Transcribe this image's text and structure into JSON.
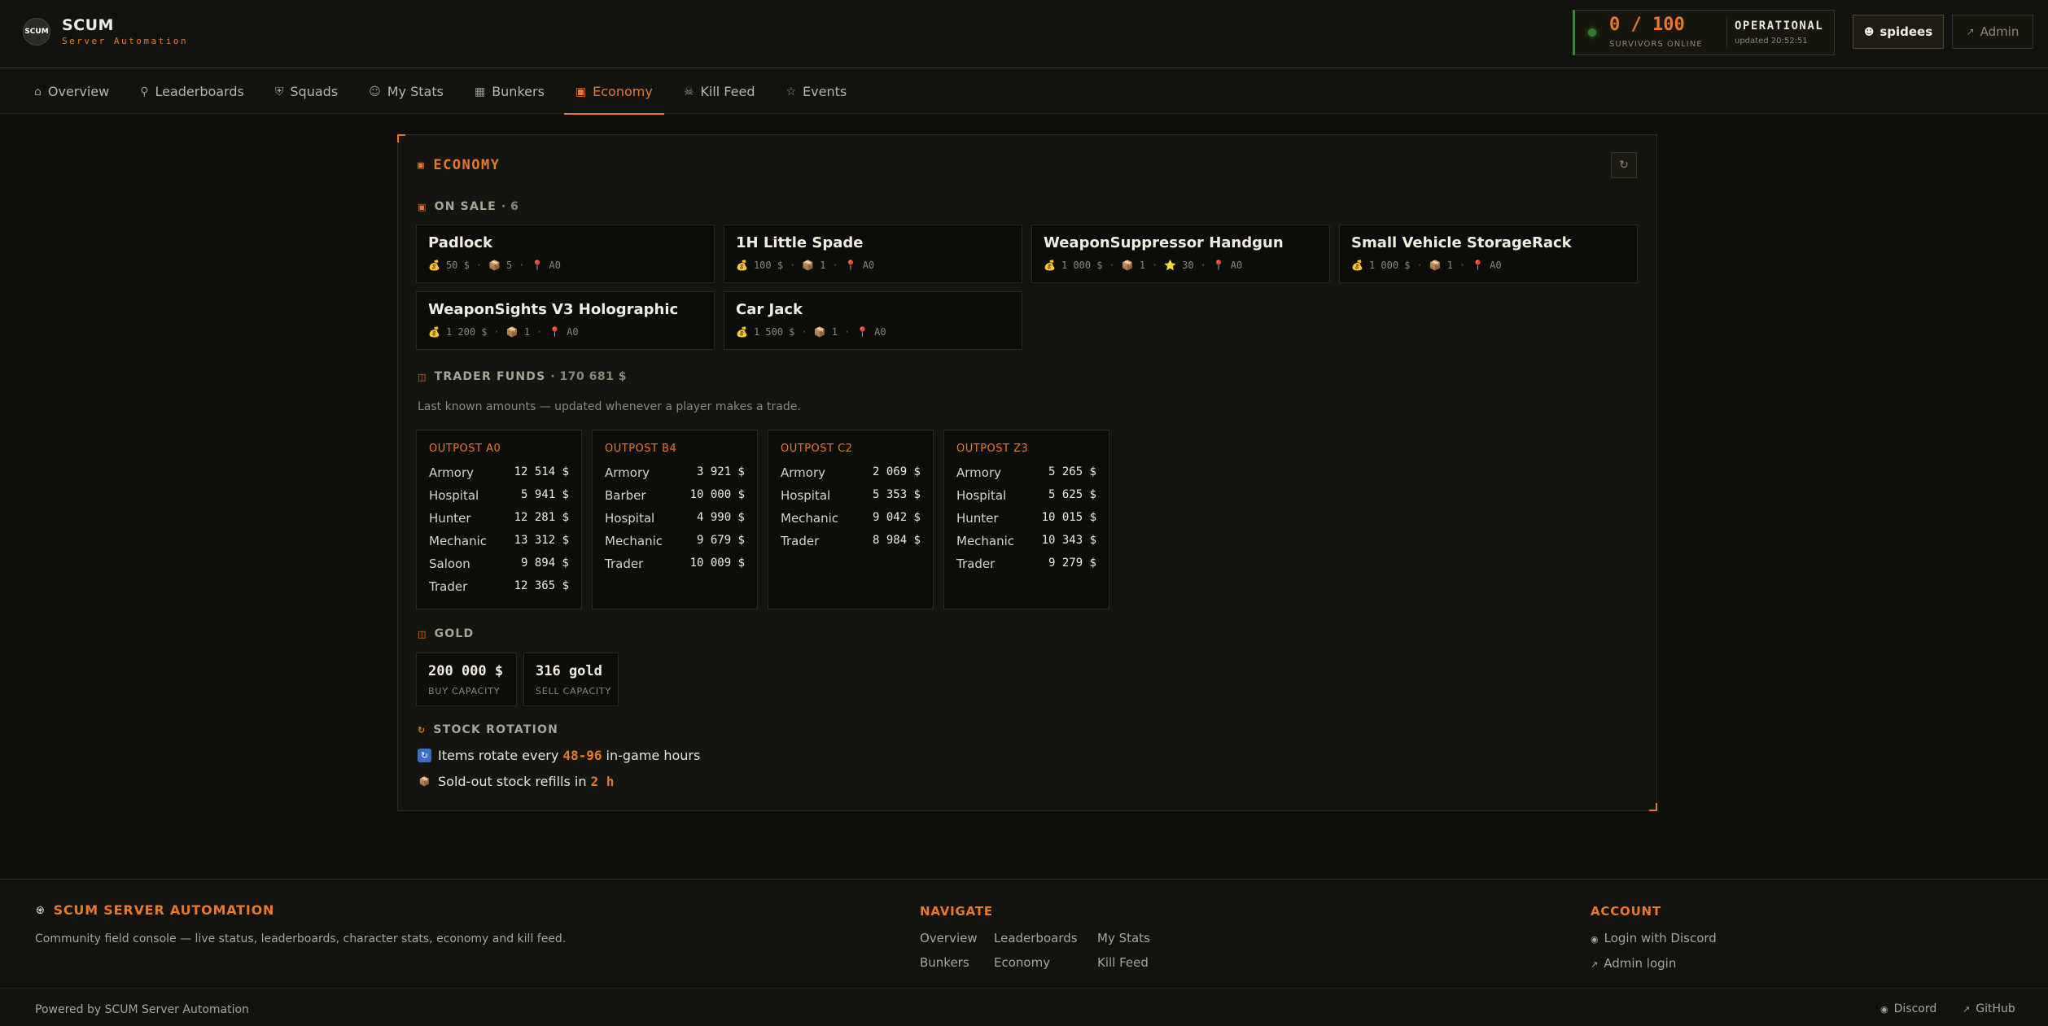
{
  "brand": {
    "logo_text": "SCUM",
    "title": "SCUM",
    "subtitle": "Server Automation"
  },
  "status": {
    "online": "0 / 100",
    "online_label": "SURVIVORS ONLINE",
    "state": "OPERATIONAL",
    "updated": "updated 20:52:51",
    "dot_color": "#2f7a2f"
  },
  "header": {
    "user_label": "spidees",
    "admin_label": "Admin"
  },
  "nav": {
    "items": [
      {
        "label": "Overview",
        "icon": "home-icon"
      },
      {
        "label": "Leaderboards",
        "icon": "trophy-icon"
      },
      {
        "label": "Squads",
        "icon": "shield-icon"
      },
      {
        "label": "My Stats",
        "icon": "user-icon"
      },
      {
        "label": "Bunkers",
        "icon": "map-icon"
      },
      {
        "label": "Economy",
        "icon": "cart-icon",
        "active": true
      },
      {
        "label": "Kill Feed",
        "icon": "skull-icon"
      },
      {
        "label": "Events",
        "icon": "star-icon"
      }
    ]
  },
  "economy": {
    "title": "ECONOMY",
    "on_sale_label": "ON SALE",
    "on_sale_count": "· 6",
    "items": [
      {
        "name": "Padlock",
        "price": "50 $",
        "stock": "5",
        "location": "A0"
      },
      {
        "name": "1H Little Spade",
        "price": "100 $",
        "stock": "1",
        "location": "A0"
      },
      {
        "name": "WeaponSuppressor Handgun",
        "price": "1 000 $",
        "stock": "1",
        "fame": "30",
        "location": "A0"
      },
      {
        "name": "Small Vehicle StorageRack",
        "price": "1 000 $",
        "stock": "1",
        "location": "A0"
      },
      {
        "name": "WeaponSights V3 Holographic",
        "price": "1 200 $",
        "stock": "1",
        "location": "A0"
      },
      {
        "name": "Car Jack",
        "price": "1 500 $",
        "stock": "1",
        "location": "A0"
      }
    ],
    "funds_label": "TRADER FUNDS",
    "funds_total": "· 170 681 $",
    "funds_note": "Last known amounts — updated whenever a player makes a trade.",
    "outposts": [
      {
        "name": "OUTPOST A0",
        "rows": [
          {
            "trader": "Armory",
            "amount": "12 514 $"
          },
          {
            "trader": "Hospital",
            "amount": "5 941 $"
          },
          {
            "trader": "Hunter",
            "amount": "12 281 $"
          },
          {
            "trader": "Mechanic",
            "amount": "13 312 $"
          },
          {
            "trader": "Saloon",
            "amount": "9 894 $"
          },
          {
            "trader": "Trader",
            "amount": "12 365 $"
          }
        ]
      },
      {
        "name": "OUTPOST B4",
        "rows": [
          {
            "trader": "Armory",
            "amount": "3 921 $"
          },
          {
            "trader": "Barber",
            "amount": "10 000 $"
          },
          {
            "trader": "Hospital",
            "amount": "4 990 $"
          },
          {
            "trader": "Mechanic",
            "amount": "9 679 $"
          },
          {
            "trader": "Trader",
            "amount": "10 009 $"
          }
        ]
      },
      {
        "name": "OUTPOST C2",
        "rows": [
          {
            "trader": "Armory",
            "amount": "2 069 $"
          },
          {
            "trader": "Hospital",
            "amount": "5 353 $"
          },
          {
            "trader": "Mechanic",
            "amount": "9 042 $"
          },
          {
            "trader": "Trader",
            "amount": "8 984 $"
          }
        ]
      },
      {
        "name": "OUTPOST Z3",
        "rows": [
          {
            "trader": "Armory",
            "amount": "5 265 $"
          },
          {
            "trader": "Hospital",
            "amount": "5 625 $"
          },
          {
            "trader": "Hunter",
            "amount": "10 015 $"
          },
          {
            "trader": "Mechanic",
            "amount": "10 343 $"
          },
          {
            "trader": "Trader",
            "amount": "9 279 $"
          }
        ]
      }
    ],
    "gold_label": "GOLD",
    "gold": {
      "buy_value": "200 000 $",
      "buy_label": "BUY CAPACITY",
      "sell_value": "316 gold",
      "sell_label": "SELL CAPACITY"
    },
    "rotation_label": "STOCK ROTATION",
    "rotation": {
      "line1_pre": "Items rotate every",
      "line1_value": "48-96",
      "line1_post": "in-game hours",
      "line2_pre": "Sold-out stock refills in",
      "line2_value": "2 h"
    }
  },
  "footer": {
    "brand": "SCUM SERVER AUTOMATION",
    "description": "Community field console — live status, leaderboards, character stats, economy and kill feed.",
    "navigate_heading": "NAVIGATE",
    "navigate": [
      "Overview",
      "Leaderboards",
      "My Stats",
      "Bunkers",
      "Economy",
      "Kill Feed"
    ],
    "account_heading": "ACCOUNT",
    "login_discord": "Login with Discord",
    "admin_login": "Admin login",
    "powered": "Powered by SCUM Server Automation",
    "discord": "Discord",
    "github": "GitHub"
  },
  "colors": {
    "accent": "#e8782a",
    "background": "#0f0f0c",
    "panel": "#15150f",
    "online": "#2f7a2f"
  }
}
